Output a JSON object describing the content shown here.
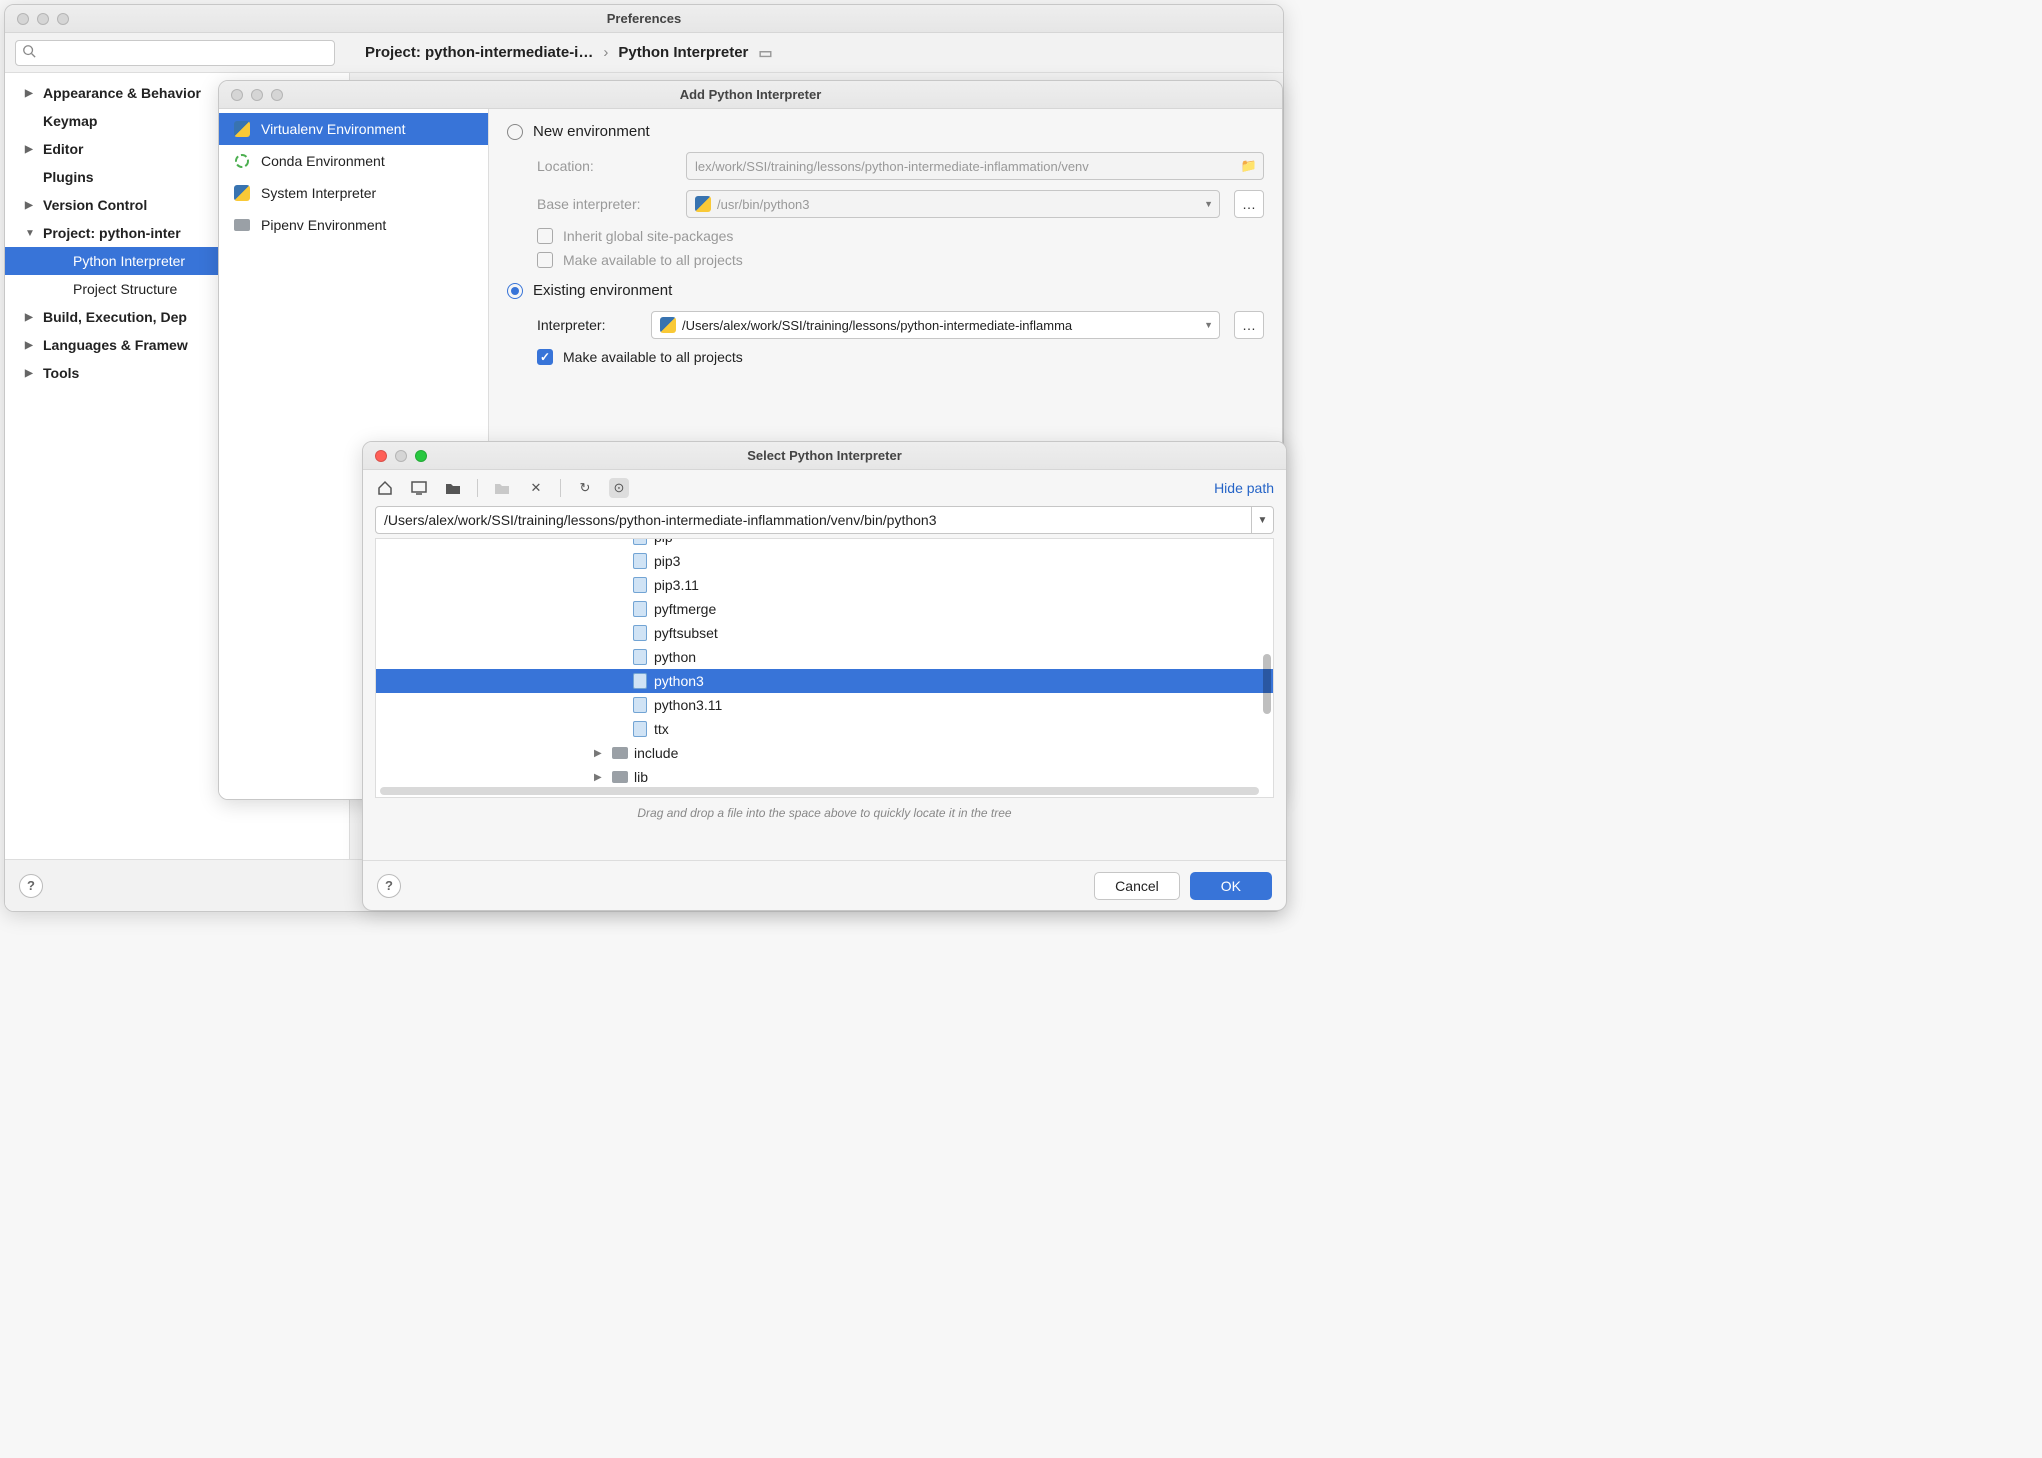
{
  "prefs": {
    "title": "Preferences",
    "breadcrumb1": "Project: python-intermediate-i…",
    "breadcrumb2": "Python Interpreter",
    "tree": [
      {
        "label": "Appearance & Behavior",
        "bold": true,
        "expandable": true
      },
      {
        "label": "Keymap",
        "bold": true
      },
      {
        "label": "Editor",
        "bold": true,
        "expandable": true
      },
      {
        "label": "Plugins",
        "bold": true
      },
      {
        "label": "Version Control",
        "bold": true,
        "expandable": true
      },
      {
        "label": "Project: python-inter",
        "bold": true,
        "expandable": true,
        "open": true
      },
      {
        "label": "Python Interpreter",
        "child": true,
        "sel": true
      },
      {
        "label": "Project Structure",
        "child": true
      },
      {
        "label": "Build, Execution, Dep",
        "bold": true,
        "expandable": true
      },
      {
        "label": "Languages & Framew",
        "bold": true,
        "expandable": true
      },
      {
        "label": "Tools",
        "bold": true,
        "expandable": true
      }
    ]
  },
  "addw": {
    "title": "Add Python Interpreter",
    "side": [
      {
        "label": "Virtualenv Environment",
        "sel": true
      },
      {
        "label": "Conda Environment"
      },
      {
        "label": "System Interpreter"
      },
      {
        "label": "Pipenv Environment"
      }
    ],
    "radio_new": "New environment",
    "location_label": "Location:",
    "location_value": "lex/work/SSI/training/lessons/python-intermediate-inflammation/venv",
    "base_label": "Base interpreter:",
    "base_value": "/usr/bin/python3",
    "chk_inherit": "Inherit global site-packages",
    "chk_make_avail1": "Make available to all projects",
    "radio_existing": "Existing environment",
    "interp_label": "Interpreter:",
    "interp_value": "/Users/alex/work/SSI/training/lessons/python-intermediate-inflamma",
    "chk_make_avail2": "Make available to all projects"
  },
  "selw": {
    "title": "Select Python Interpreter",
    "hide_path": "Hide path",
    "path": "/Users/alex/work/SSI/training/lessons/python-intermediate-inflammation/venv/bin/python3",
    "items": [
      {
        "name": "pip",
        "type": "py",
        "cutoff": true
      },
      {
        "name": "pip3",
        "type": "py"
      },
      {
        "name": "pip3.11",
        "type": "py"
      },
      {
        "name": "pyftmerge",
        "type": "py"
      },
      {
        "name": "pyftsubset",
        "type": "py"
      },
      {
        "name": "python",
        "type": "bin"
      },
      {
        "name": "python3",
        "type": "bin",
        "sel": true
      },
      {
        "name": "python3.11",
        "type": "bin"
      },
      {
        "name": "ttx",
        "type": "py"
      }
    ],
    "folders": [
      {
        "name": "include"
      },
      {
        "name": "lib"
      }
    ],
    "hint": "Drag and drop a file into the space above to quickly locate it in the tree",
    "cancel": "Cancel",
    "ok": "OK"
  }
}
